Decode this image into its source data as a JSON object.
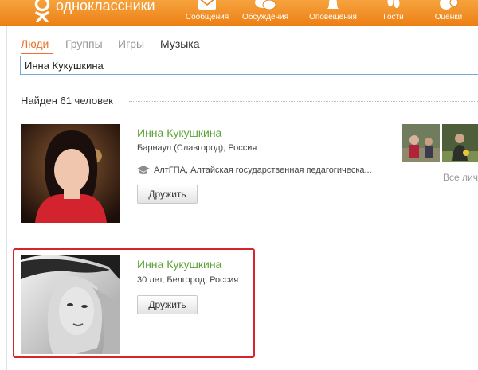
{
  "header": {
    "logo_text": "одноклассники",
    "nav": [
      {
        "label": "Сообщения",
        "icon": "envelope-icon"
      },
      {
        "label": "Обсуждения",
        "icon": "chat-bubbles-icon"
      },
      {
        "label": "Оповещения",
        "icon": "bell-icon"
      },
      {
        "label": "Гости",
        "icon": "footprints-icon"
      },
      {
        "label": "Оценки",
        "icon": "ratings-icon"
      }
    ]
  },
  "tabs": [
    "Люди",
    "Группы",
    "Игры",
    "Музыка"
  ],
  "search": {
    "value": "Инна Кукушкина"
  },
  "results_count": "Найден 61 человек",
  "results": [
    {
      "name": "Инна Кукушкина",
      "location": "Барнаул (Славгород), Россия",
      "education": "АлтГПА, Алтайская государственная педагогическа...",
      "button": "Дружить"
    },
    {
      "name": "Инна Кукушкина",
      "location": "30 лет, Белгород, Россия",
      "button": "Дружить"
    }
  ],
  "side": {
    "all_label": "Все лич"
  },
  "colors": {
    "brand_orange": "#ee8208",
    "name_green": "#5ba336",
    "highlight_red": "#d6262c"
  }
}
